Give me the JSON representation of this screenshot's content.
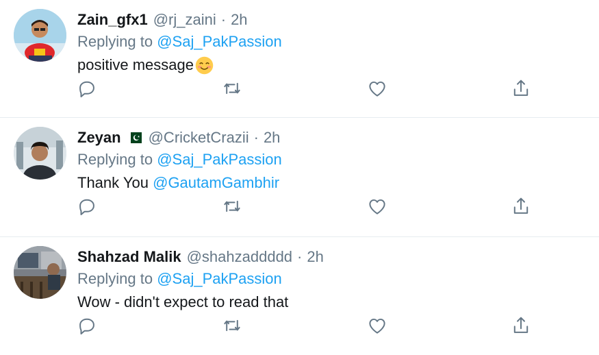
{
  "tweets": [
    {
      "name": "Zain_gfx1",
      "handle": "@rj_zaini",
      "dot": "·",
      "time": "2h",
      "replying_prefix": "Replying to",
      "replying_to": "@Saj_PakPassion",
      "text_parts": [
        "positive message",
        ""
      ],
      "emoji": "smiling-face-icon"
    },
    {
      "name": "Zeyan",
      "flag": "pakistan-flag-icon",
      "handle": "@CricketCrazii",
      "dot": "·",
      "time": "2h",
      "replying_prefix": "Replying to",
      "replying_to": "@Saj_PakPassion",
      "text_parts": [
        "Thank You",
        "@GautamGambhir"
      ]
    },
    {
      "name": "Shahzad Malik",
      "handle": "@shahzaddddd",
      "dot": "·",
      "time": "2h",
      "replying_prefix": "Replying to",
      "replying_to": "@Saj_PakPassion",
      "text_parts": [
        "Wow - didn't expect to read that",
        ""
      ]
    }
  ],
  "colors": {
    "primary_text": "#14171a",
    "secondary_text": "#657786",
    "link": "#1da1f2",
    "icon": "#657786",
    "divider": "#e6ecf0"
  },
  "actions": [
    "reply-icon",
    "retweet-icon",
    "like-icon",
    "share-icon"
  ]
}
